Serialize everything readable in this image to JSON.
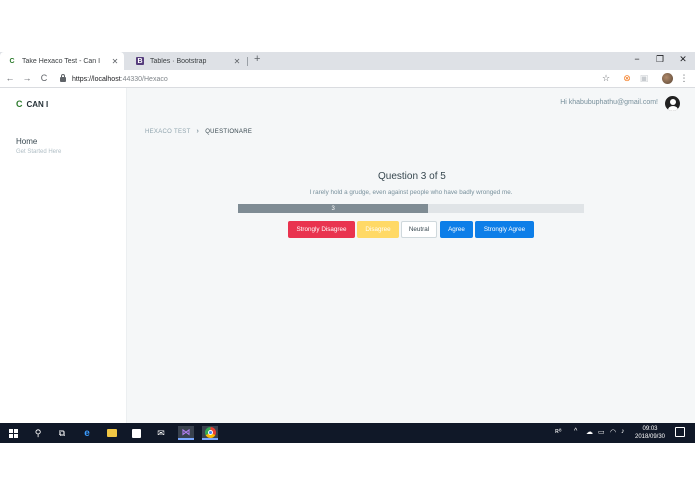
{
  "browser": {
    "tabs": [
      {
        "title": "Take Hexaco Test - Can I",
        "favicon": "C",
        "close": "✕"
      },
      {
        "title": "Tables · Bootstrap",
        "favicon": "B",
        "close": "✕"
      }
    ],
    "new_tab": "+",
    "window_controls": {
      "minimize": "−",
      "restore": "❐",
      "close": "✕"
    },
    "nav": {
      "back": "←",
      "forward": "→",
      "reload": "C"
    },
    "url_scheme_host": "https://localhost",
    "url_rest": ":44330/Hexaco",
    "bookmark_icon": "☆",
    "ext_icon": "⊗",
    "menu_icon": "⋮"
  },
  "sidebar": {
    "brand_icon": "C",
    "brand_name": "CAN I",
    "home": "Home",
    "subtitle": "Get Started Here"
  },
  "header": {
    "greeting": "Hi khabubuphathu@gmail.com!"
  },
  "breadcrumb": {
    "root": "HEXACO TEST",
    "separator": "›",
    "current": "QUESTIONARE"
  },
  "question": {
    "title": "Question 3 of 5",
    "text": "I rarely hold a grudge, even against people who have badly wronged me.",
    "progress_label": "3",
    "progress_fraction": 0.55
  },
  "answers": {
    "strongly_disagree": "Strongly Disagree",
    "disagree": "Disagree",
    "neutral": "Neutral",
    "agree": "Agree",
    "strongly_agree": "Strongly Agree"
  },
  "colors": {
    "strongly_disagree": "#e9334f",
    "disagree": "#ffd966",
    "agree": "#0d7ee8",
    "strongly_agree": "#0d7ee8"
  },
  "taskbar": {
    "tray_lang": "ʀ⁸",
    "clock_time": "09:03",
    "clock_date": "2018/09/30"
  }
}
